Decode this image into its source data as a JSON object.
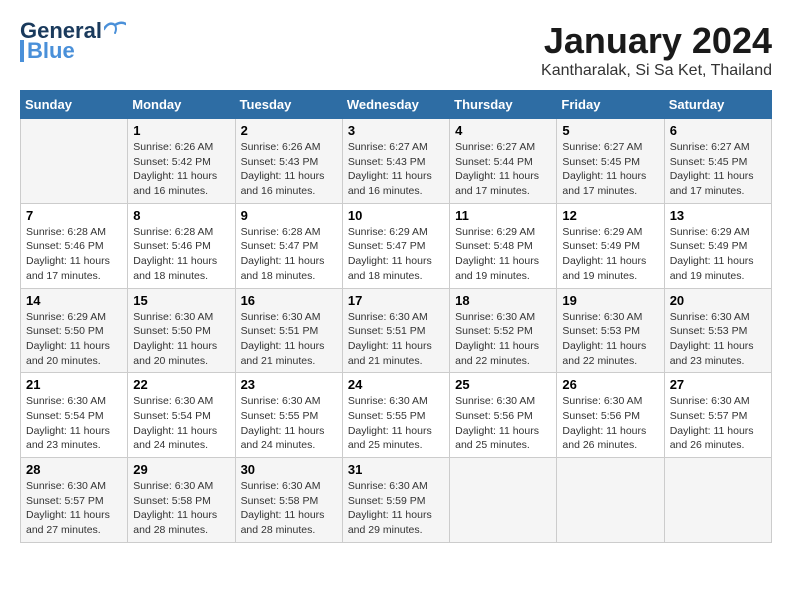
{
  "logo": {
    "line1": "General",
    "line2": "Blue"
  },
  "title": "January 2024",
  "subtitle": "Kantharalak, Si Sa Ket, Thailand",
  "weekdays": [
    "Sunday",
    "Monday",
    "Tuesday",
    "Wednesday",
    "Thursday",
    "Friday",
    "Saturday"
  ],
  "weeks": [
    [
      {
        "day": "",
        "sunrise": "",
        "sunset": "",
        "daylight": ""
      },
      {
        "day": "1",
        "sunrise": "6:26 AM",
        "sunset": "5:42 PM",
        "daylight": "11 hours and 16 minutes."
      },
      {
        "day": "2",
        "sunrise": "6:26 AM",
        "sunset": "5:43 PM",
        "daylight": "11 hours and 16 minutes."
      },
      {
        "day": "3",
        "sunrise": "6:27 AM",
        "sunset": "5:43 PM",
        "daylight": "11 hours and 16 minutes."
      },
      {
        "day": "4",
        "sunrise": "6:27 AM",
        "sunset": "5:44 PM",
        "daylight": "11 hours and 17 minutes."
      },
      {
        "day": "5",
        "sunrise": "6:27 AM",
        "sunset": "5:45 PM",
        "daylight": "11 hours and 17 minutes."
      },
      {
        "day": "6",
        "sunrise": "6:27 AM",
        "sunset": "5:45 PM",
        "daylight": "11 hours and 17 minutes."
      }
    ],
    [
      {
        "day": "7",
        "sunrise": "6:28 AM",
        "sunset": "5:46 PM",
        "daylight": "11 hours and 17 minutes."
      },
      {
        "day": "8",
        "sunrise": "6:28 AM",
        "sunset": "5:46 PM",
        "daylight": "11 hours and 18 minutes."
      },
      {
        "day": "9",
        "sunrise": "6:28 AM",
        "sunset": "5:47 PM",
        "daylight": "11 hours and 18 minutes."
      },
      {
        "day": "10",
        "sunrise": "6:29 AM",
        "sunset": "5:47 PM",
        "daylight": "11 hours and 18 minutes."
      },
      {
        "day": "11",
        "sunrise": "6:29 AM",
        "sunset": "5:48 PM",
        "daylight": "11 hours and 19 minutes."
      },
      {
        "day": "12",
        "sunrise": "6:29 AM",
        "sunset": "5:49 PM",
        "daylight": "11 hours and 19 minutes."
      },
      {
        "day": "13",
        "sunrise": "6:29 AM",
        "sunset": "5:49 PM",
        "daylight": "11 hours and 19 minutes."
      }
    ],
    [
      {
        "day": "14",
        "sunrise": "6:29 AM",
        "sunset": "5:50 PM",
        "daylight": "11 hours and 20 minutes."
      },
      {
        "day": "15",
        "sunrise": "6:30 AM",
        "sunset": "5:50 PM",
        "daylight": "11 hours and 20 minutes."
      },
      {
        "day": "16",
        "sunrise": "6:30 AM",
        "sunset": "5:51 PM",
        "daylight": "11 hours and 21 minutes."
      },
      {
        "day": "17",
        "sunrise": "6:30 AM",
        "sunset": "5:51 PM",
        "daylight": "11 hours and 21 minutes."
      },
      {
        "day": "18",
        "sunrise": "6:30 AM",
        "sunset": "5:52 PM",
        "daylight": "11 hours and 22 minutes."
      },
      {
        "day": "19",
        "sunrise": "6:30 AM",
        "sunset": "5:53 PM",
        "daylight": "11 hours and 22 minutes."
      },
      {
        "day": "20",
        "sunrise": "6:30 AM",
        "sunset": "5:53 PM",
        "daylight": "11 hours and 23 minutes."
      }
    ],
    [
      {
        "day": "21",
        "sunrise": "6:30 AM",
        "sunset": "5:54 PM",
        "daylight": "11 hours and 23 minutes."
      },
      {
        "day": "22",
        "sunrise": "6:30 AM",
        "sunset": "5:54 PM",
        "daylight": "11 hours and 24 minutes."
      },
      {
        "day": "23",
        "sunrise": "6:30 AM",
        "sunset": "5:55 PM",
        "daylight": "11 hours and 24 minutes."
      },
      {
        "day": "24",
        "sunrise": "6:30 AM",
        "sunset": "5:55 PM",
        "daylight": "11 hours and 25 minutes."
      },
      {
        "day": "25",
        "sunrise": "6:30 AM",
        "sunset": "5:56 PM",
        "daylight": "11 hours and 25 minutes."
      },
      {
        "day": "26",
        "sunrise": "6:30 AM",
        "sunset": "5:56 PM",
        "daylight": "11 hours and 26 minutes."
      },
      {
        "day": "27",
        "sunrise": "6:30 AM",
        "sunset": "5:57 PM",
        "daylight": "11 hours and 26 minutes."
      }
    ],
    [
      {
        "day": "28",
        "sunrise": "6:30 AM",
        "sunset": "5:57 PM",
        "daylight": "11 hours and 27 minutes."
      },
      {
        "day": "29",
        "sunrise": "6:30 AM",
        "sunset": "5:58 PM",
        "daylight": "11 hours and 28 minutes."
      },
      {
        "day": "30",
        "sunrise": "6:30 AM",
        "sunset": "5:58 PM",
        "daylight": "11 hours and 28 minutes."
      },
      {
        "day": "31",
        "sunrise": "6:30 AM",
        "sunset": "5:59 PM",
        "daylight": "11 hours and 29 minutes."
      },
      {
        "day": "",
        "sunrise": "",
        "sunset": "",
        "daylight": ""
      },
      {
        "day": "",
        "sunrise": "",
        "sunset": "",
        "daylight": ""
      },
      {
        "day": "",
        "sunrise": "",
        "sunset": "",
        "daylight": ""
      }
    ]
  ],
  "labels": {
    "sunrise_prefix": "Sunrise: ",
    "sunset_prefix": "Sunset: ",
    "daylight_prefix": "Daylight: "
  }
}
